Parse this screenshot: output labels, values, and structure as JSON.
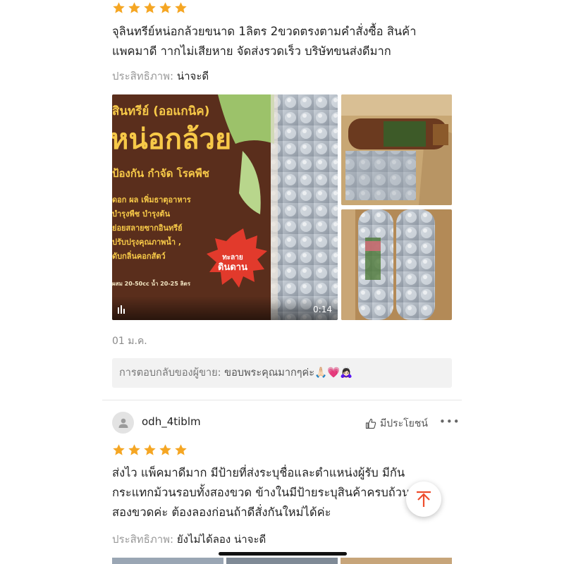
{
  "colors": {
    "star": "#f5a623",
    "accent": "#ee4d2d"
  },
  "review1": {
    "rating": 5,
    "text_line1": "จุลินทรีย์หน่อกล้วยขนาด 1ลิตร 2ขวดตรงตามคำสั่งซื้อ สินค้า",
    "text_line2": "แพคมาดี าากไม่เสียหาย จัดส่งรวดเร็ว บริษัทขนส่งดีมาก",
    "effectiveness_label": "ประสิทธิภาพ:",
    "effectiveness_value": "น่าจะดี",
    "video": {
      "label_organic": "สินทรีย์ (ออแกนิค)",
      "label_name": "หน่อกล้วย",
      "label_disease": "ป้องกัน กำจัด โรคพืช",
      "label_line1": "ดอก ผล เพิ่มธาตุอาหาร",
      "label_line2": "บำรุงพืช บำรุงต้น",
      "label_line3": "ย่อยสลายซากอินทรีย์",
      "label_line4": "ปรับปรุงคุณภาพน้ำ ,",
      "label_line5": "ดับกลิ่นคอกสัตว์",
      "label_dose": "ผสม 20-50cc น้ำ 20-25 ลิตร",
      "label_badge_top": "ทะลาย",
      "label_badge_bottom": "ดินดาน",
      "duration": "0:14"
    },
    "date": "01 ม.ค.",
    "seller_reply_label": "การตอบกลับของผู้ขาย:",
    "seller_reply_text": "ขอบพระคุณมากๆค่ะ🙏🏻💗🙇🏻‍♀️"
  },
  "review2": {
    "username": "odh_4tiblm",
    "helpful_label": "มีประโยชน์",
    "more": "•••",
    "rating": 5,
    "text_line1": "ส่งไว แพ็คมาดีมาก มีป้ายที่ส่งระบุชื่อและตำแหน่งผู้รับ มีกัน",
    "text_line2": "กระแทกม้วนรอบทั้งสองขวด ข้างในมีป้ายระบุสินค้าครบถ้วน",
    "text_line3": "สองขวดค่ะ ต้องลองก่อนถ้าดีสั่งกันใหม่ได้ค่ะ",
    "effectiveness_label": "ประสิทธิภาพ:",
    "effectiveness_value": "ยังไม่ได้ลอง น่าจะดี"
  },
  "icons": {
    "star": "star-icon",
    "play": "video-play-icon",
    "avatar": "person-icon",
    "thumbs_up": "thumbs-up-icon",
    "scroll_top": "arrow-up-icon"
  }
}
